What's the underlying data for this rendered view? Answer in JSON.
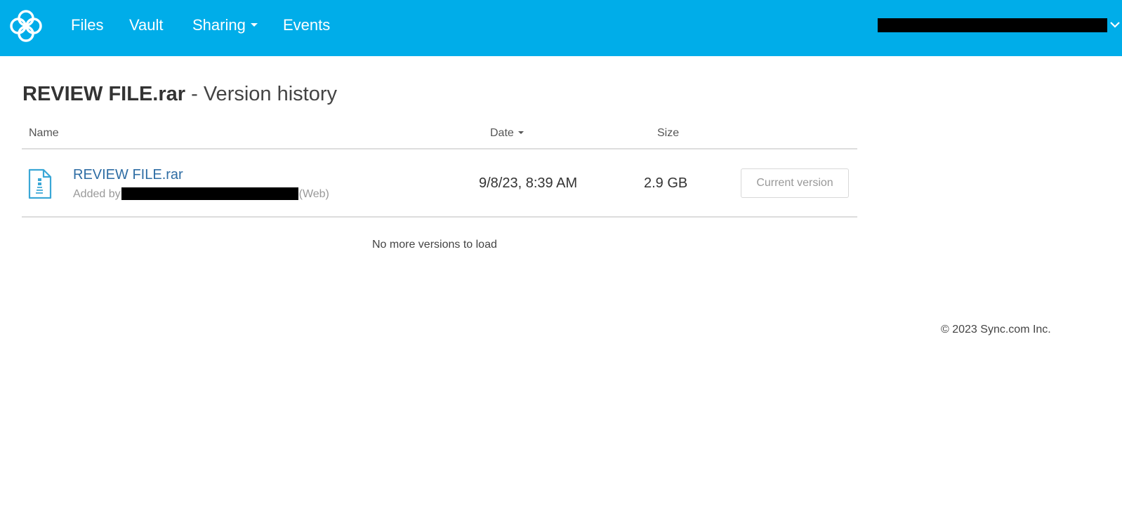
{
  "navbar": {
    "background_color": "#00ade9",
    "logo_icon": "sync-logo-icon",
    "items": [
      {
        "label": "Files"
      },
      {
        "label": "Vault"
      },
      {
        "label": "Sharing",
        "has_dropdown": true
      },
      {
        "label": "Events"
      }
    ],
    "account": {
      "redacted": true,
      "menu_icon": "chevron-down-icon"
    }
  },
  "page": {
    "file_name": "REVIEW FILE.rar",
    "title_suffix": " - Version history"
  },
  "table": {
    "columns": {
      "name": "Name",
      "date": "Date",
      "size": "Size"
    },
    "sort": {
      "column": "Date",
      "direction": "descending"
    },
    "rows": [
      {
        "icon": "file-archive-icon",
        "name": "REVIEW FILE.rar",
        "added_by_prefix": "Added by",
        "added_by_user_redacted": true,
        "added_by_source": "(Web)",
        "date": "9/8/23, 8:39 AM",
        "size": "2.9 GB",
        "action_label": "Current version"
      }
    ],
    "end_message": "No more versions to load"
  },
  "footer": {
    "copyright": "© 2023 Sync.com Inc."
  }
}
